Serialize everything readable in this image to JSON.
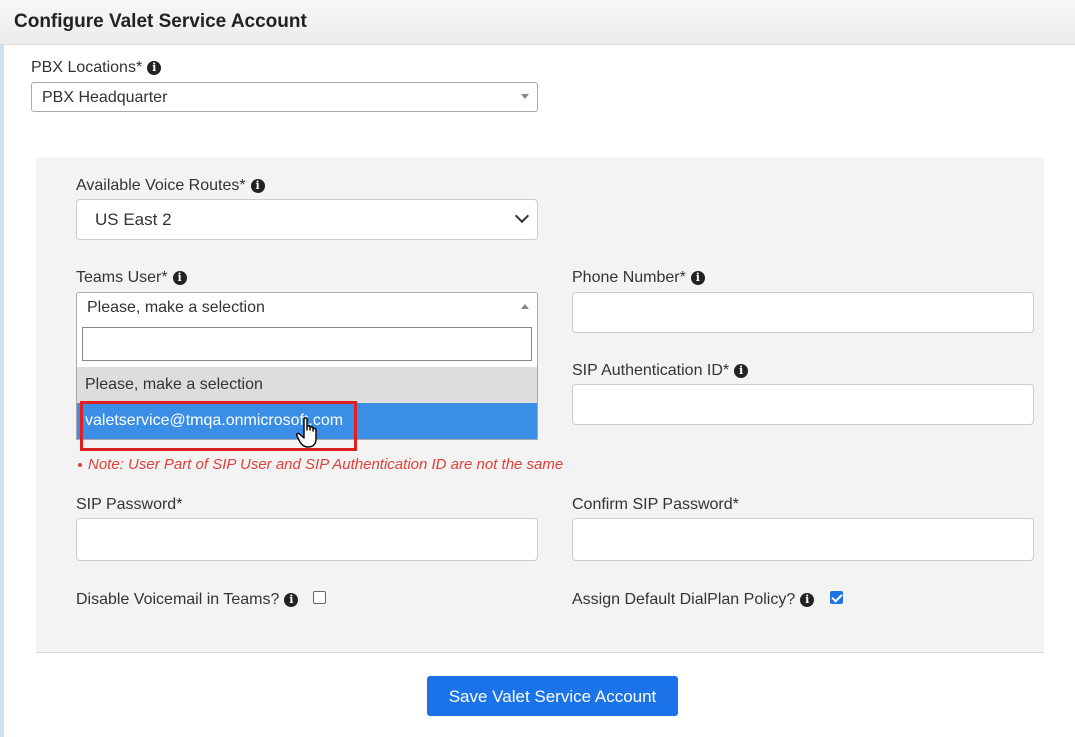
{
  "page": {
    "title": "Configure Valet Service Account"
  },
  "pbx": {
    "label": "PBX Locations*",
    "value": "PBX Headquarter"
  },
  "voice_routes": {
    "label": "Available Voice Routes*",
    "value": "US East 2"
  },
  "teams_user": {
    "label": "Teams User*",
    "value": "Please, make a selection",
    "search_value": "",
    "options": [
      "Please, make a selection",
      "valetservice@tmqa.onmicrosoft.com"
    ],
    "selected_option_index": 1
  },
  "phone_number": {
    "label": "Phone Number*",
    "value": ""
  },
  "sip_auth_id": {
    "label": "SIP Authentication ID*",
    "value": ""
  },
  "note": "Note: User Part of SIP User and SIP Authentication ID are not the same",
  "sip_password": {
    "label": "SIP Password*",
    "value": ""
  },
  "confirm_sip_password": {
    "label": "Confirm SIP Password*",
    "value": ""
  },
  "disable_voicemail": {
    "label": "Disable Voicemail in Teams?",
    "checked": false
  },
  "assign_dialplan": {
    "label": "Assign Default DialPlan Policy?",
    "checked": true
  },
  "save_button": {
    "label": "Save Valet Service Account"
  },
  "colors": {
    "accent": "#1a73e8",
    "highlight_option": "#3a8ee6",
    "note": "#e0403a",
    "annotation_box": "#e02020"
  }
}
